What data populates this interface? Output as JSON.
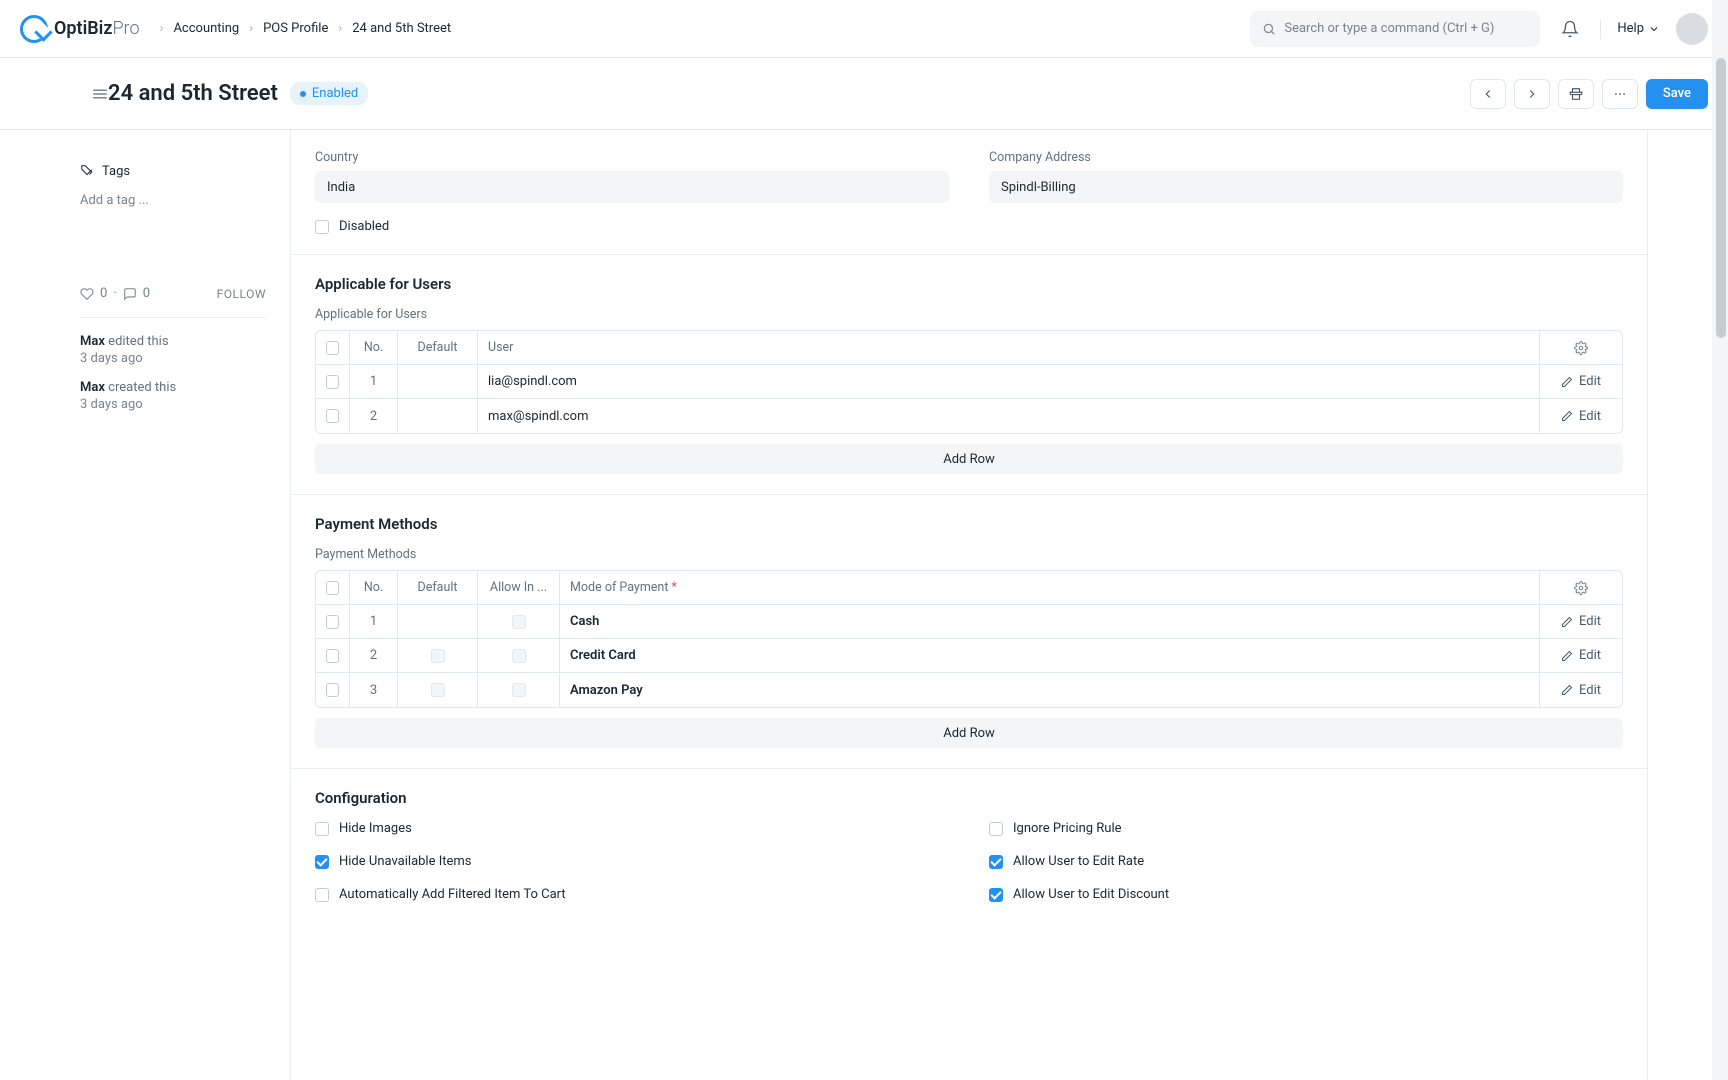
{
  "brand": {
    "name1": "OptiBiz",
    "name2": "Pro"
  },
  "breadcrumb": [
    "Accounting",
    "POS Profile",
    "24 and 5th Street"
  ],
  "search_placeholder": "Search or type a command (Ctrl + G)",
  "help_label": "Help",
  "page": {
    "title": "24 and 5th Street",
    "status": "Enabled",
    "save": "Save"
  },
  "sidebar": {
    "tags_label": "Tags",
    "add_tag": "Add a tag ...",
    "likes": "0",
    "comments": "0",
    "follow": "FOLLOW",
    "activity": [
      {
        "who": "Max",
        "what": "edited this",
        "when": "3 days ago"
      },
      {
        "who": "Max",
        "what": "created this",
        "when": "3 days ago"
      }
    ]
  },
  "top_fields": {
    "country_label": "Country",
    "country": "India",
    "address_label": "Company Address",
    "address": "Spindl-Billing",
    "disabled_label": "Disabled"
  },
  "users_section": {
    "title": "Applicable for Users",
    "sublabel": "Applicable for Users",
    "cols": {
      "no": "No.",
      "default": "Default",
      "user": "User"
    },
    "rows": [
      {
        "no": "1",
        "default": true,
        "user": "lia@spindl.com"
      },
      {
        "no": "2",
        "default": true,
        "user": "max@spindl.com"
      }
    ],
    "add_row": "Add Row",
    "edit": "Edit"
  },
  "payments_section": {
    "title": "Payment Methods",
    "sublabel": "Payment Methods",
    "cols": {
      "no": "No.",
      "default": "Default",
      "allow": "Allow In ...",
      "mode": "Mode of Payment"
    },
    "rows": [
      {
        "no": "1",
        "default": true,
        "allow": false,
        "mode": "Cash"
      },
      {
        "no": "2",
        "default": false,
        "allow": false,
        "mode": "Credit Card"
      },
      {
        "no": "3",
        "default": false,
        "allow": false,
        "mode": "Amazon Pay"
      }
    ],
    "add_row": "Add Row",
    "edit": "Edit"
  },
  "config_section": {
    "title": "Configuration",
    "left": [
      {
        "label": "Hide Images",
        "on": false
      },
      {
        "label": "Hide Unavailable Items",
        "on": true
      },
      {
        "label": "Automatically Add Filtered Item To Cart",
        "on": false
      }
    ],
    "right": [
      {
        "label": "Ignore Pricing Rule",
        "on": false
      },
      {
        "label": "Allow User to Edit Rate",
        "on": true
      },
      {
        "label": "Allow User to Edit Discount",
        "on": true
      }
    ]
  }
}
